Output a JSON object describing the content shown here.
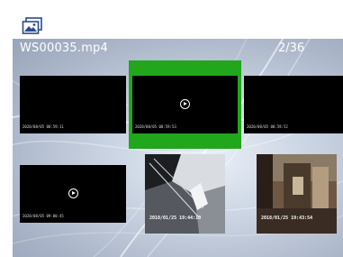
{
  "header": {
    "icon": "gallery-icon"
  },
  "viewer": {
    "filename": "WS00035.mp4",
    "position": "2/36",
    "selected_index": 1,
    "accent_color": "#22a61c"
  },
  "thumbnails": [
    {
      "kind": "video",
      "timestamp": "2020/08/05  08:59:11"
    },
    {
      "kind": "video",
      "timestamp": "2020/08/05  08:59:53",
      "icon": "play-icon"
    },
    {
      "kind": "video",
      "timestamp": "2020/08/05  08:59:52"
    },
    {
      "kind": "video",
      "timestamp": "2020/08/05  09:00:45",
      "icon": "play-icon"
    },
    {
      "kind": "photo",
      "timestamp": "2018/01/25  19:44:10"
    },
    {
      "kind": "photo",
      "timestamp": "2018/01/25  19:43:54"
    }
  ]
}
